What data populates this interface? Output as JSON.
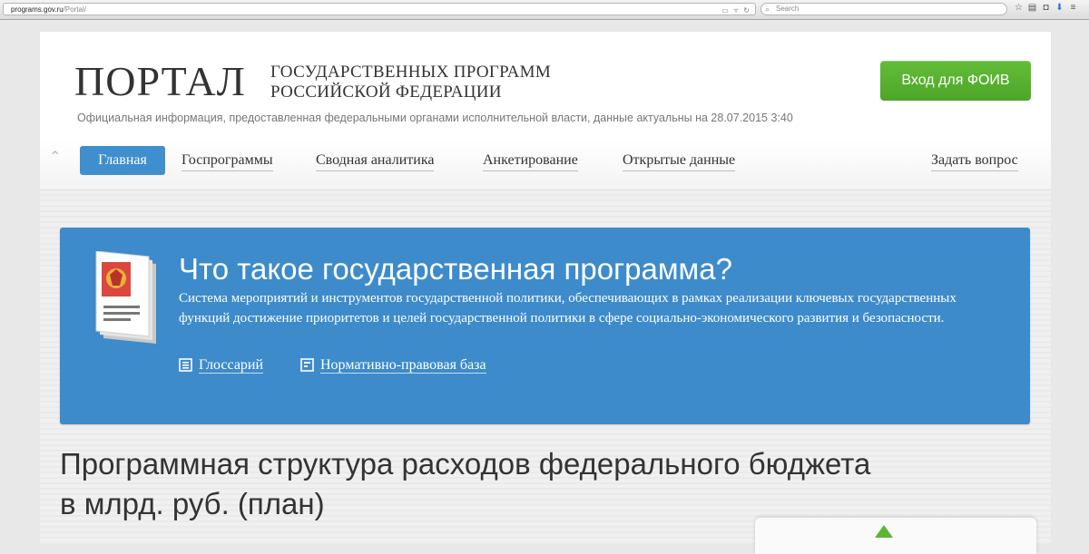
{
  "browser": {
    "url_host": "programs.gov.ru",
    "url_path": "/Portal/",
    "search_placeholder": "Search"
  },
  "header": {
    "logo_main": "ПОРТАЛ",
    "logo_sub_line1": "ГОСУДАРСТВЕННЫХ ПРОГРАММ",
    "logo_sub_line2": "РОССИЙСКОЙ ФЕДЕРАЦИИ",
    "official_note": "Официальная информация, предоставленная федеральными органами исполнительной власти, данные актуальны на 28.07.2015 3:40",
    "login_button": "Вход для ФОИВ"
  },
  "nav": {
    "items": [
      {
        "label": "Главная",
        "active": true
      },
      {
        "label": "Госпрограммы"
      },
      {
        "label": "Сводная аналитика"
      },
      {
        "label": "Анкетирование"
      },
      {
        "label": "Открытые данные"
      }
    ],
    "ask_question": "Задать вопрос"
  },
  "info_card": {
    "title": "Что такое государственная программа?",
    "description": "Система мероприятий и инструментов государственной политики, обеспечивающих в рамках реализации ключевых государственных функций достижение приоритетов и целей государственной политики в сфере социально-экономического развития и безопасности.",
    "links": {
      "glossary": "Глоссарий",
      "legal_base": "Нормативно-правовая база"
    }
  },
  "section": {
    "title_line1": "Программная структура расходов федерального бюджета",
    "title_line2": "в млрд. руб. (план)"
  },
  "colors": {
    "accent_blue": "#3d8bcb",
    "login_green": "#56ae2f",
    "nav_active": "#3f8fcf"
  }
}
